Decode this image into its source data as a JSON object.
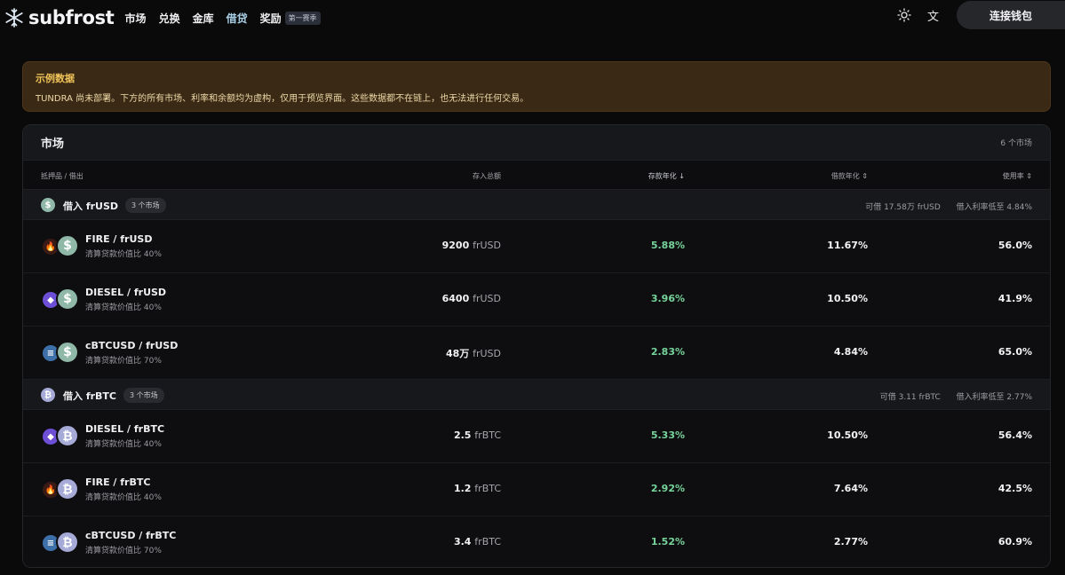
{
  "brand": {
    "name": "subfrost"
  },
  "nav": {
    "links": [
      "市场",
      "兑换",
      "金库",
      "借贷",
      "奖励"
    ],
    "season_badge": "第一赛季",
    "theme_icon": "sun-icon",
    "lang_label": "文",
    "connect_label": "连接钱包"
  },
  "banner": {
    "title": "示例数据",
    "text": "TUNDRA 尚未部署。下方的所有市场、利率和余额均为虚构，仅用于预览界面。这些数据都不在链上，也无法进行任何交易。"
  },
  "table": {
    "title": "市场",
    "count": "6 个市场",
    "columns": {
      "pair": "抵押品 / 借出",
      "supply": "存入总额",
      "supply_apy": "存款年化 ↓",
      "borrow_apy": "借款年化 ⇕",
      "utilization": "使用率 ⇕"
    },
    "groups": [
      {
        "label": "借入 frUSD",
        "badge": "3 个市场",
        "available": "可借 17.58万 frUSD",
        "min_rate": "借入利率低至 4.84%",
        "icon_color": "#8fb8a8",
        "icon_glyph": "$",
        "rows": [
          {
            "pair": "FIRE / frUSD",
            "sub": "清算贷款价值比 40%",
            "base_icon": "fire-icon",
            "base_color": "#3a1a14",
            "base_glyph": "🔥",
            "supply_value": "9200",
            "supply_unit": "frUSD",
            "apy": "5.88%",
            "borrow": "11.67%",
            "util": "56.0%"
          },
          {
            "pair": "DIESEL / frUSD",
            "sub": "清算贷款价值比 40%",
            "base_icon": "diesel-icon",
            "base_color": "#6d4fd6",
            "base_glyph": "◆",
            "supply_value": "6400",
            "supply_unit": "frUSD",
            "apy": "3.96%",
            "borrow": "10.50%",
            "util": "41.9%"
          },
          {
            "pair": "cBTCUSD / frUSD",
            "sub": "清算贷款价值比 70%",
            "base_icon": "cbtcusd-icon",
            "base_color": "#3d6fa8",
            "base_glyph": "≡",
            "supply_value": "48万",
            "supply_unit": "frUSD",
            "apy": "2.83%",
            "borrow": "4.84%",
            "util": "65.0%"
          }
        ]
      },
      {
        "label": "借入 frBTC",
        "badge": "3 个市场",
        "available": "可借 3.11 frBTC",
        "min_rate": "借入利率低至 2.77%",
        "icon_color": "#a6aad6",
        "icon_glyph": "₿",
        "rows": [
          {
            "pair": "DIESEL / frBTC",
            "sub": "清算贷款价值比 40%",
            "base_icon": "diesel-icon",
            "base_color": "#6d4fd6",
            "base_glyph": "◆",
            "supply_value": "2.5",
            "supply_unit": "frBTC",
            "apy": "5.33%",
            "borrow": "10.50%",
            "util": "56.4%"
          },
          {
            "pair": "FIRE / frBTC",
            "sub": "清算贷款价值比 40%",
            "base_icon": "fire-icon",
            "base_color": "#3a1a14",
            "base_glyph": "🔥",
            "supply_value": "1.2",
            "supply_unit": "frBTC",
            "apy": "2.92%",
            "borrow": "7.64%",
            "util": "42.5%"
          },
          {
            "pair": "cBTCUSD / frBTC",
            "sub": "清算贷款价值比 70%",
            "base_icon": "cbtcusd-icon",
            "base_color": "#3d6fa8",
            "base_glyph": "≡",
            "supply_value": "3.4",
            "supply_unit": "frBTC",
            "apy": "1.52%",
            "borrow": "2.77%",
            "util": "60.9%"
          }
        ]
      }
    ]
  }
}
